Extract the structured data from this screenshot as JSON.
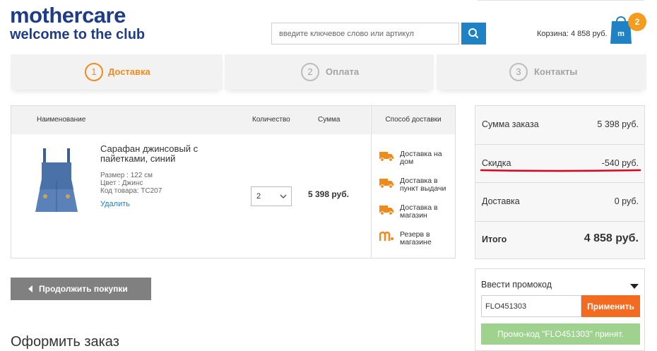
{
  "header": {
    "brand": "mothercare",
    "tagline": "welcome to the club",
    "search_placeholder": "введите ключевое слово или артикул",
    "cart_label": "Корзина: 4 858 руб.",
    "cart_count": "2"
  },
  "steps": [
    {
      "num": "1",
      "label": "Доставка"
    },
    {
      "num": "2",
      "label": "Оплата"
    },
    {
      "num": "3",
      "label": "Контакты"
    }
  ],
  "order": {
    "headers": {
      "name": "Наименование",
      "qty": "Количество",
      "sum": "Сумма",
      "shipping": "Способ доставки"
    },
    "item": {
      "name": "Сарафан джинсовый с пайетками, синий",
      "size": "Размер : 122 см",
      "color": "Цвет : Джинс",
      "code": "Код товара: TC207",
      "remove": "Удалить",
      "qty": "2",
      "sum": "5 398 руб."
    },
    "shipping_options": [
      {
        "icon": "truck-icon",
        "label": "Доставка на дом"
      },
      {
        "icon": "truck-icon",
        "label": "Доставка в пункт выдачи"
      },
      {
        "icon": "truck-icon",
        "label": "Доставка в магазин"
      },
      {
        "icon": "mothercare-logo-icon",
        "label": "Резерв в магазине"
      }
    ]
  },
  "summary": {
    "order_sum_label": "Сумма заказа",
    "order_sum": "5 398 руб.",
    "discount_label": "Скидка",
    "discount": "-540 руб.",
    "delivery_label": "Доставка",
    "delivery": "0 руб.",
    "total_label": "Итого",
    "total": "4 858 руб."
  },
  "continue_label": "Продолжить покупки",
  "checkout_title": "Оформить заказ",
  "promo": {
    "title": "Ввести промокод",
    "code": "FLO451303",
    "apply": "Применить",
    "accepted": "Промо-код \"FLO451303\" принят."
  },
  "colors": {
    "brand": "#1f3c88",
    "accent": "#f08a1c",
    "search": "#1e82c4",
    "apply": "#f26b21",
    "success": "#9fd18f",
    "underline": "#e0001a"
  }
}
